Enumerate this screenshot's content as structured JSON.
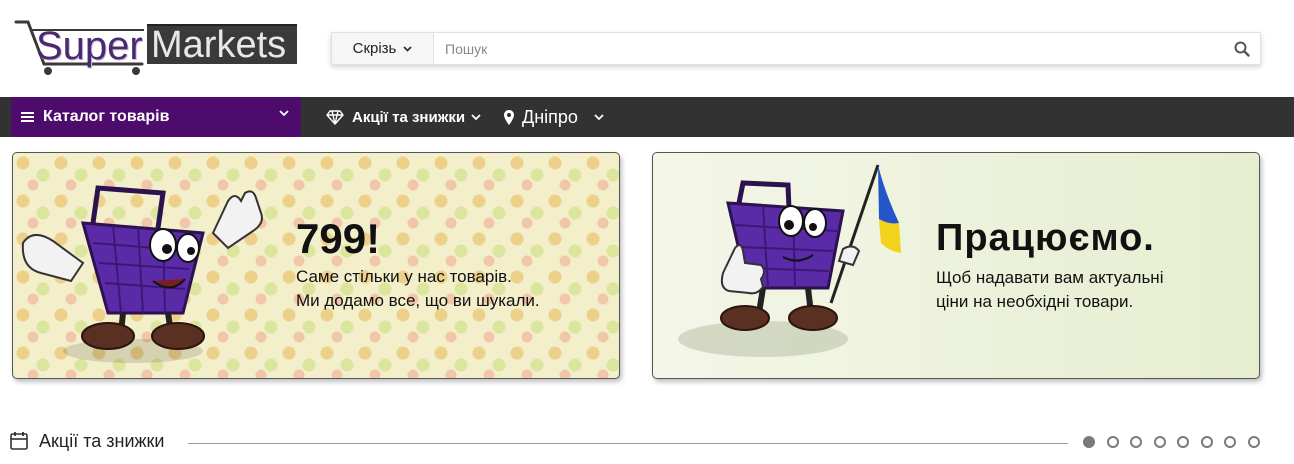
{
  "header": {
    "logo": {
      "super": "Super",
      "markets": "Markets"
    },
    "search": {
      "scope_label": "Скрізь",
      "placeholder": "Пошук",
      "icon": "search-icon"
    }
  },
  "navbar": {
    "catalog_label": "Каталог товарів",
    "promo_label": "Акції та знижки",
    "city_label": "Дніпро",
    "colors": {
      "bar": "#323232",
      "catalog": "#4d0b6b"
    }
  },
  "banners": [
    {
      "title": "799!",
      "line1": "Саме стільки у нас товарів.",
      "line2": "Ми додамо все, що ви шукали."
    },
    {
      "title": "Працюємо.",
      "line1": "Щоб надавати вам актуальні",
      "line2": "ціни на необхідні товари."
    }
  ],
  "section": {
    "title": "Акції та знижки",
    "pager": {
      "count": 8,
      "active_index": 0
    }
  }
}
